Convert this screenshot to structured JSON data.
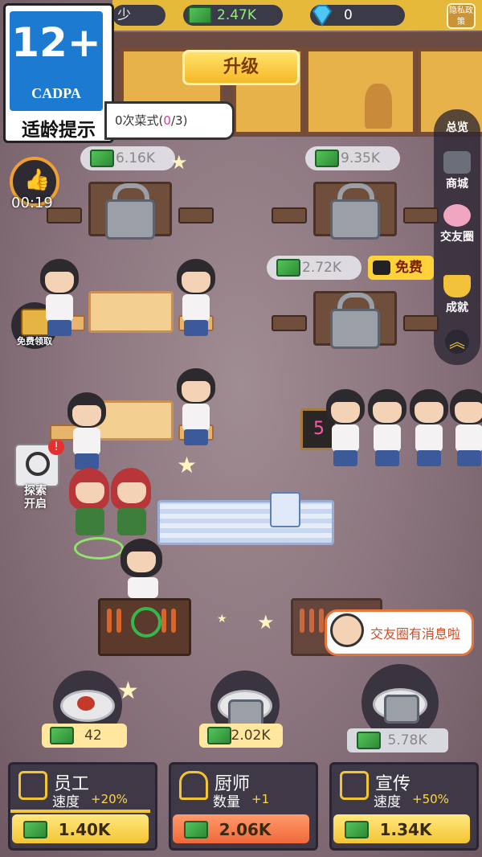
{
  "top_bar": {
    "cut_label": "少",
    "cash": "2.47K",
    "diamonds": "0",
    "privacy_label": "隐私政策"
  },
  "age_rating": {
    "rating": "12+",
    "org": "CADPA",
    "caption": "适龄提示"
  },
  "upgrade_button": "升级",
  "task": {
    "text": "0次菜式(",
    "done": "0",
    "sep": "/",
    "total": "3",
    "close": ")"
  },
  "timer": {
    "time": "00:19"
  },
  "free_reward": "免费领取",
  "explore": {
    "line1": "探索",
    "line2": "开启"
  },
  "side_menu": [
    {
      "label": "总览",
      "icon": "overview-icon"
    },
    {
      "label": "商城",
      "icon": "shop-icon"
    },
    {
      "label": "交友圈",
      "icon": "friends-icon"
    },
    {
      "label": "成就",
      "icon": "trophy-icon"
    }
  ],
  "locked_tables": [
    {
      "price": "6.16K"
    },
    {
      "price": "9.35K"
    },
    {
      "price": "2.72K",
      "free_label": "免费"
    }
  ],
  "queue_number": "5",
  "chat_bubble": "交友圈有消息啦",
  "dishes": [
    {
      "price": "42",
      "locked": false
    },
    {
      "price": "2.02K",
      "locked": true
    },
    {
      "price": "5.78K",
      "locked": true
    }
  ],
  "upgrades": [
    {
      "title": "员工",
      "stat": "速度",
      "bonus": "+20%",
      "price": "1.40K",
      "icon": "staff-icon"
    },
    {
      "title": "厨师",
      "stat": "数量",
      "bonus": "+1",
      "price": "2.06K",
      "icon": "chef-hat-icon"
    },
    {
      "title": "宣传",
      "stat": "速度",
      "bonus": "+50%",
      "price": "1.34K",
      "icon": "promo-icon"
    }
  ],
  "colors": {
    "gold": "#f4c533",
    "green_money": "#54c35a",
    "panel": "#3e3847"
  }
}
